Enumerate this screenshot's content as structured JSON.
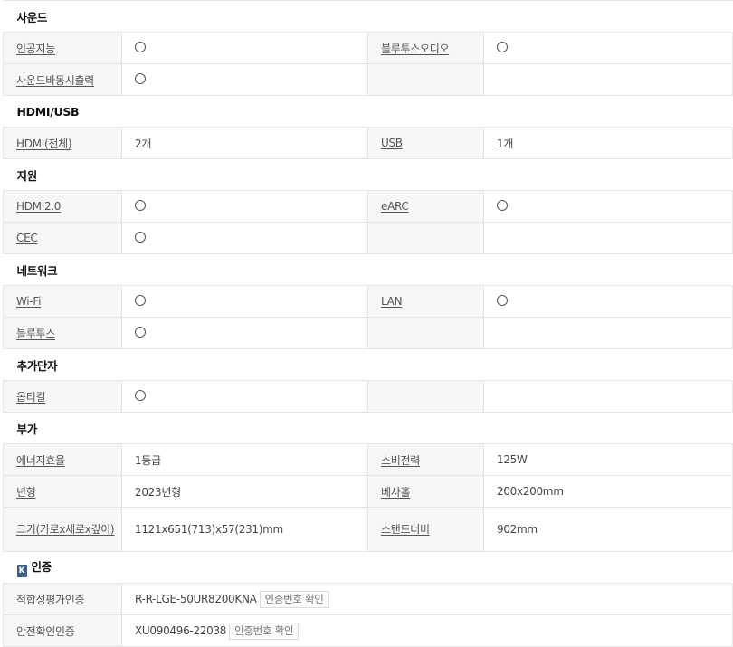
{
  "sections": {
    "sound": {
      "title": "사운드",
      "rows": [
        {
          "l1": "인공지능",
          "v1": "○",
          "l2": "블루투스오디오",
          "v2": "○"
        },
        {
          "l1": "사운드바동시출력",
          "v1": "○",
          "l2": "",
          "v2": ""
        }
      ]
    },
    "hdmi_usb": {
      "title": "HDMI/USB",
      "rows": [
        {
          "l1": "HDMI(전체)",
          "v1": "2개",
          "l2": "USB",
          "v2": "1개"
        }
      ]
    },
    "support": {
      "title": "지원",
      "rows": [
        {
          "l1": "HDMI2.0",
          "v1": "○",
          "l2": "eARC",
          "v2": "○"
        },
        {
          "l1": "CEC",
          "v1": "○",
          "l2": "",
          "v2": ""
        }
      ]
    },
    "network": {
      "title": "네트워크",
      "rows": [
        {
          "l1": "Wi-Fi",
          "v1": "○",
          "l2": "LAN",
          "v2": "○"
        },
        {
          "l1": "블루투스",
          "v1": "○",
          "l2": "",
          "v2": ""
        }
      ]
    },
    "extra_ports": {
      "title": "추가단자",
      "rows": [
        {
          "l1": "옵티컬",
          "v1": "○",
          "l2": "",
          "v2": ""
        }
      ]
    },
    "additional": {
      "title": "부가",
      "rows": [
        {
          "l1": "에너지효율",
          "v1": "1등급",
          "l2": "소비전력",
          "v2": "125W"
        },
        {
          "l1": "년형",
          "v1": "2023년형",
          "l2": "베사홀",
          "v2": "200x200mm"
        },
        {
          "l1": "크기(가로x세로x깊이)",
          "v1": "1121x651(713)x57(231)mm",
          "l2": "스탠드너비",
          "v2": "902mm"
        }
      ]
    },
    "certification": {
      "title": "인증",
      "icon": "kc-mark-icon",
      "rows": [
        {
          "label": "적합성평가인증",
          "value": "R-R-LGE-50UR8200KNA",
          "button": "인증번호 확인"
        },
        {
          "label": "안전확인인증",
          "value": "XU090496-22038",
          "button": "인증번호 확인"
        }
      ]
    }
  }
}
